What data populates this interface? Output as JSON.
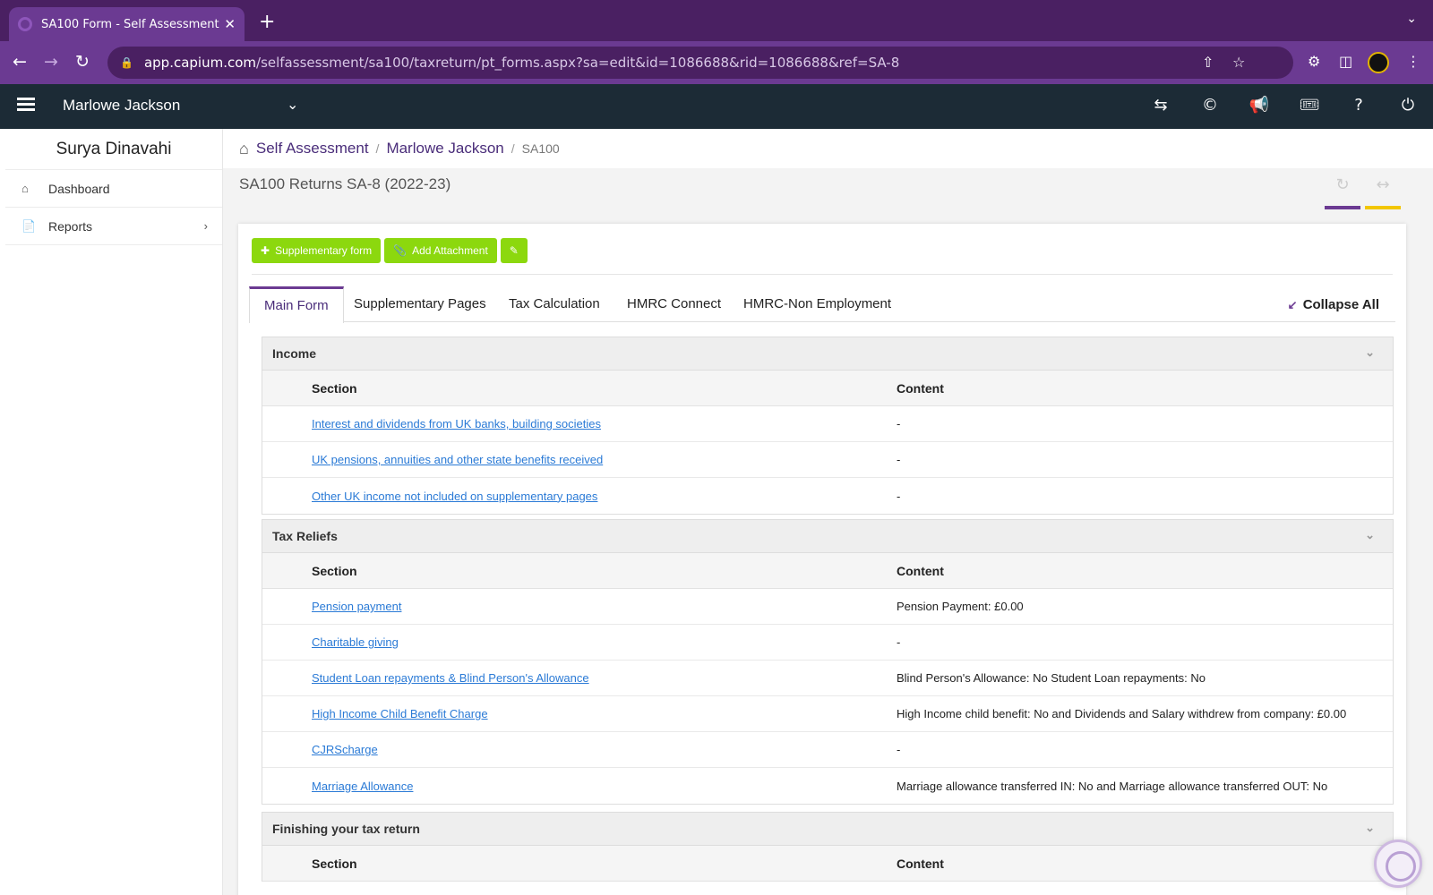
{
  "browser": {
    "tab_title": "SA100 Form - Self Assessment",
    "new_tab": "+",
    "close_tab": "✕",
    "url_host": "app.capium.com",
    "url_path": "/selfassessment/sa100/taxreturn/pt_forms.aspx?sa=edit&id=1086688&rid=1086688&ref=SA-8"
  },
  "header": {
    "client_name": "Marlowe Jackson"
  },
  "sidebar": {
    "user_name": "Surya Dinavahi",
    "items": [
      {
        "label": "Dashboard",
        "icon": "home-icon"
      },
      {
        "label": "Reports",
        "icon": "document-icon"
      }
    ]
  },
  "breadcrumb": {
    "items": [
      "Self Assessment",
      "Marlowe Jackson"
    ],
    "current": "SA100",
    "separator": "/"
  },
  "page": {
    "title": "SA100 Returns SA-8 (2022-23)"
  },
  "actions": {
    "supplementary_form": "Supplementary form",
    "add_attachment": "Add Attachment"
  },
  "tabs": {
    "items": [
      "Main Form",
      "Supplementary Pages",
      "Tax Calculation",
      "HMRC Connect",
      "HMRC-Non Employment"
    ],
    "active": "Main Form",
    "collapse_all": "Collapse All"
  },
  "columns": {
    "section": "Section",
    "content": "Content"
  },
  "sections": [
    {
      "title": "Income",
      "rows": [
        {
          "section": "Interest and dividends from UK banks, building societies",
          "content": "-"
        },
        {
          "section": "UK pensions, annuities and other state benefits received",
          "content": "-"
        },
        {
          "section": "Other UK income not included on supplementary pages",
          "content": "-"
        }
      ]
    },
    {
      "title": "Tax Reliefs",
      "rows": [
        {
          "section": "Pension payment",
          "content": "Pension Payment: £0.00"
        },
        {
          "section": "Charitable giving",
          "content": "-"
        },
        {
          "section": "Student Loan repayments & Blind Person's Allowance",
          "content": "Blind Person's Allowance: No Student Loan repayments: No"
        },
        {
          "section": "High Income Child Benefit Charge",
          "content": "High Income child benefit: No and Dividends and Salary withdrew from company: £0.00"
        },
        {
          "section": "CJRScharge",
          "content": "-"
        },
        {
          "section": "Marriage Allowance",
          "content": "Marriage allowance transferred IN: No and Marriage allowance transferred OUT: No"
        }
      ]
    },
    {
      "title": "Finishing your tax return",
      "rows": []
    }
  ],
  "colors": {
    "tabstrip": "#4a2062",
    "toolbar": "#6b3a92",
    "appbar": "#1c2b36",
    "accent_purple": "#6b3a92",
    "accent_yellow": "#f2c600",
    "button_green": "#8cd80e",
    "link_blue": "#2a7ad6"
  }
}
